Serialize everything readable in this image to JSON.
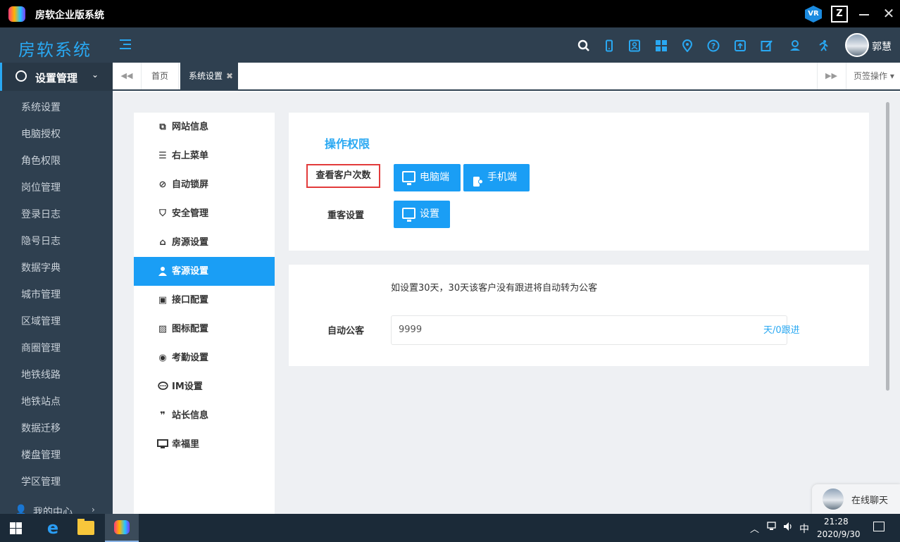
{
  "window": {
    "title": "房软企业版系统",
    "controls": {
      "minimize_icon": "minimize-icon",
      "close_glyph": "✕"
    }
  },
  "header": {
    "brand": "房软系统",
    "icons": [
      "search-icon",
      "mobile-icon",
      "contact-card-icon",
      "grid-icon",
      "location-pin-icon",
      "help-icon",
      "upload-icon",
      "edit-icon",
      "user-pin-icon",
      "runner-icon"
    ],
    "username": "郭慧"
  },
  "sidebar": {
    "group_label": "设置管理",
    "items": [
      {
        "label": "系统设置"
      },
      {
        "label": "电脑授权"
      },
      {
        "label": "角色权限"
      },
      {
        "label": "岗位管理"
      },
      {
        "label": "登录日志"
      },
      {
        "label": "隐号日志"
      },
      {
        "label": "数据字典"
      },
      {
        "label": "城市管理"
      },
      {
        "label": "区域管理"
      },
      {
        "label": "商圈管理"
      },
      {
        "label": "地铁线路"
      },
      {
        "label": "地铁站点"
      },
      {
        "label": "数据迁移"
      },
      {
        "label": "楼盘管理"
      },
      {
        "label": "学区管理"
      }
    ],
    "bottom_group": "我的中心"
  },
  "tabs": {
    "home": "首页",
    "active": "系统设置",
    "close_glyph": "✖",
    "prev_glyph": "◀◀",
    "next_glyph": "▶▶",
    "ops": "页签操作 ▾"
  },
  "settings_menu": {
    "active_index": 5,
    "items": [
      {
        "label": "网站信息",
        "icon": "site-icon",
        "glyph": "⧉"
      },
      {
        "label": "右上菜单",
        "icon": "list-icon",
        "glyph": "☰"
      },
      {
        "label": "自动锁屏",
        "icon": "ban-icon",
        "glyph": "⊘"
      },
      {
        "label": "安全管理",
        "icon": "shield-icon",
        "glyph": "⛉"
      },
      {
        "label": "房源设置",
        "icon": "home-icon",
        "glyph": "⌂"
      },
      {
        "label": "客源设置",
        "icon": "user-icon",
        "glyph": "👤"
      },
      {
        "label": "接口配置",
        "icon": "api-icon",
        "glyph": "▣"
      },
      {
        "label": "图标配置",
        "icon": "image-icon",
        "glyph": "▨"
      },
      {
        "label": "考勤设置",
        "icon": "pin-icon",
        "glyph": "◉"
      },
      {
        "label": "IM设置",
        "icon": "chat-icon",
        "glyph": "💬"
      },
      {
        "label": "站长信息",
        "icon": "quote-icon",
        "glyph": "❞"
      },
      {
        "label": "幸福里",
        "icon": "monitor-icon",
        "glyph": "▭"
      }
    ]
  },
  "permissions": {
    "title": "操作权限",
    "view_count_label": "查看客户次数",
    "pc_button": "电脑端",
    "mobile_button": "手机端",
    "duplicate_label": "重客设置",
    "settings_button": "设置"
  },
  "auto_public": {
    "hint": "如设置30天，30天该客户没有跟进将自动转为公客",
    "label": "自动公客",
    "value": "9999",
    "unit": "天/0跟进"
  },
  "chat": {
    "label": "在线聊天"
  },
  "taskbar": {
    "tray_chevron": "︿",
    "ime": "中",
    "time": "21:28",
    "date": "2020/9/30"
  },
  "colors": {
    "accent": "#1a9ef5",
    "sidebar": "#2f4050",
    "highlight_border": "#e23b3b"
  }
}
